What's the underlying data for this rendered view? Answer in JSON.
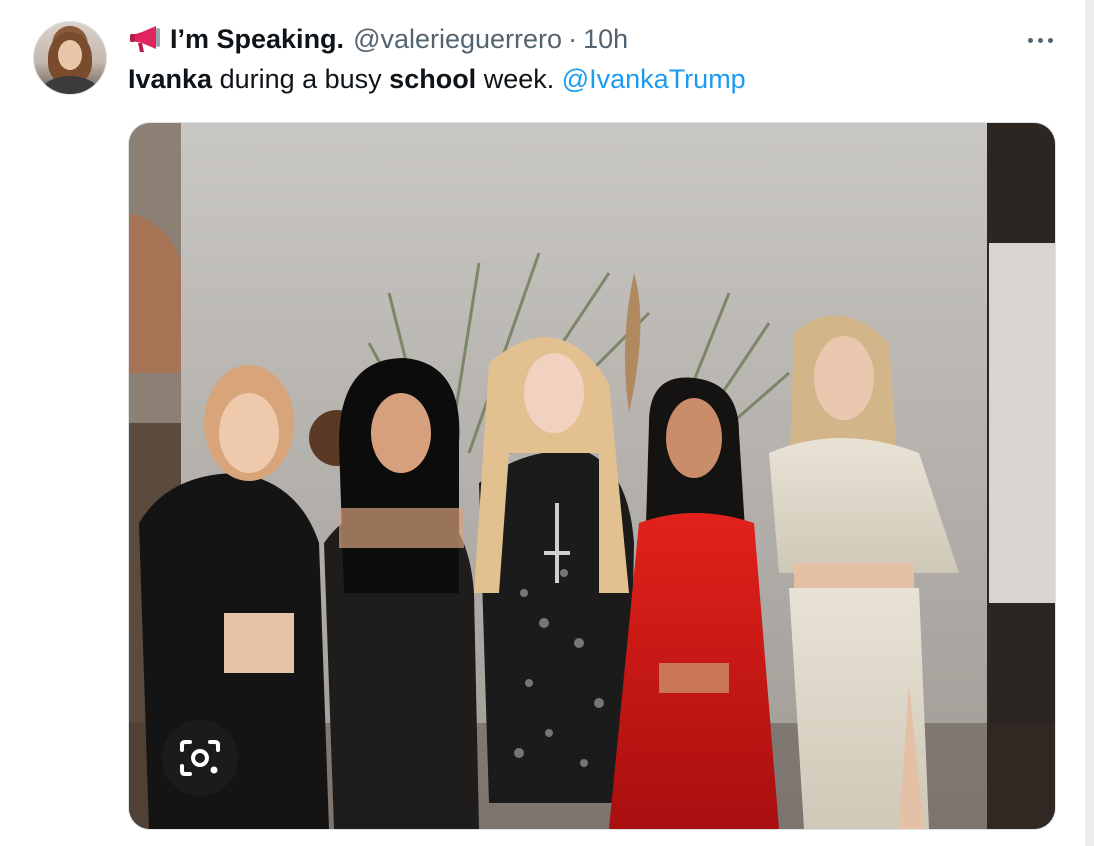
{
  "tweet": {
    "display_name": "I’m Speaking.",
    "handle": "@valerieguerrero",
    "separator": "·",
    "time": "10h",
    "text_parts": {
      "w1": "Ivanka",
      "w2": " during a busy ",
      "w3": "school",
      "w4": " week. ",
      "mention": "@IvankaTrump"
    },
    "more_icon": "ellipsis-icon",
    "badge_icon": "megaphone-icon"
  },
  "media": {
    "alt_icon": "visual-search-icon"
  },
  "colors": {
    "text": "#0f1419",
    "secondary_text": "#536471",
    "link": "#1d9bf0",
    "megaphone_red": "#e0245e"
  }
}
